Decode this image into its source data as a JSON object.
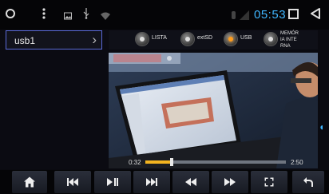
{
  "status_bar": {
    "clock": "05:53",
    "icons": [
      "circle-icon",
      "more-vert-icon",
      "gallery-icon",
      "usb-icon",
      "wifi-icon",
      "mute-icon",
      "no-signal-icon",
      "square-icon",
      "back-triangle-icon"
    ]
  },
  "source_selector": {
    "label": "usb1"
  },
  "sources": {
    "options": [
      {
        "label": "LISTA",
        "selected": false
      },
      {
        "label": "extSD",
        "selected": false
      },
      {
        "label": "USB",
        "selected": true
      },
      {
        "label": "MEMÓR IA INTE RNA",
        "selected": false
      }
    ],
    "memory_label_lines": [
      "MEMÓR",
      "IA INTE",
      "RNA"
    ]
  },
  "player": {
    "current_time": "0:32",
    "total_time": "2:50",
    "progress": 0.19
  },
  "controls": [
    "home-icon",
    "skip-previous-icon",
    "play-pause-icon",
    "skip-next-icon",
    "rewind-icon",
    "fast-forward-icon",
    "fullscreen-icon",
    "return-icon"
  ],
  "colors": {
    "accent": "#3fb6ff",
    "active_radio": "#ff9d1e",
    "progress": "#f2b320"
  }
}
